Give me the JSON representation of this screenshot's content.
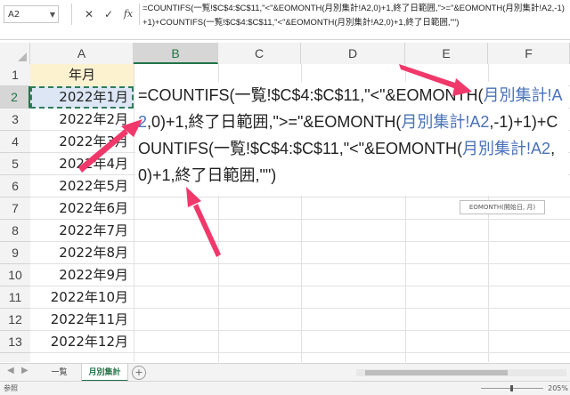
{
  "formula_bar": {
    "name_box": "A2",
    "cancel_icon": "✕",
    "enter_icon": "✓",
    "fx_label": "fx",
    "formula": "=COUNTIFS(一覧!$C$4:$C$11,\"<\"&EOMONTH(月別集計!A2,0)+1,終了日範囲,\">=\"&EOMONTH(月別集計!A2,-1)+1)+COUNTIFS(一覧!$C$4:$C$11,\"<\"&EOMONTH(月別集計!A2,0)+1,終了日範囲,\"\")"
  },
  "columns": [
    "A",
    "B",
    "C",
    "D",
    "E",
    "F"
  ],
  "rows": [
    "1",
    "2",
    "3",
    "4",
    "5",
    "6",
    "7",
    "8",
    "9",
    "10",
    "11",
    "12",
    "13"
  ],
  "cells": {
    "a1": "年月",
    "a_values": [
      "2022年1月",
      "2022年2月",
      "2022年3月",
      "2022年4月",
      "2022年5月",
      "2022年6月",
      "2022年7月",
      "2022年8月",
      "2022年9月",
      "2022年10月",
      "2022年11月",
      "2022年12月"
    ]
  },
  "editing": {
    "p1": "=COUNTIFS(一覧!$C$4:$C$11,\"<\"&EOMONTH(",
    "ref1": "月別集計!A2",
    "p2": ",0)+1,終了日範囲,\">=\"&EOMONTH(",
    "ref2": "月別集計!A2",
    "p3": ",-1)+1)+COUNTIFS(一覧!$C$4:$C$11,\"<\"&EOMONTH(",
    "ref3": "月別集計!A2",
    "p4": ",0)+1,終了日範囲,\"\")",
    "tooltip": "EOMONTH(開始日, 月)"
  },
  "sheets": {
    "tabs": [
      "一覧",
      "月別集計"
    ],
    "active": "月別集計",
    "add_icon": "+"
  },
  "status": {
    "text": "参照",
    "zoom": "205%"
  },
  "colors": {
    "accent": "#217346",
    "arrow": "#f0386b",
    "reference_blue": "#4a72b8"
  }
}
